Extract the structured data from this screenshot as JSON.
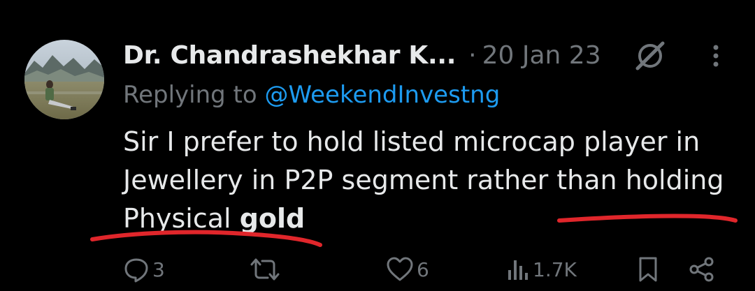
{
  "tweet": {
    "author_name": "Dr. Chandrashekhar K...",
    "separator": "·",
    "date": "20 Jan 23",
    "replying_prefix": "Replying to",
    "replying_handle": "@WeekendInvestng",
    "body_lines": [
      "Sir I prefer to hold listed microcap player in",
      "Jewellery in P2P segment rather than holding"
    ],
    "body_last_line_prefix": "Physical",
    "body_bold_word": "gold",
    "icons": {
      "grok": "grok-icon",
      "more": "more-vertical-icon",
      "reply": "reply-icon",
      "retweet": "retweet-icon",
      "like": "heart-icon",
      "views": "views-icon",
      "bookmark": "bookmark-icon",
      "share": "share-icon"
    }
  },
  "actions": {
    "replies": "3",
    "retweets": "",
    "likes": "6",
    "views": "1.7K"
  },
  "colors": {
    "background": "#000000",
    "text": "#e7e9ea",
    "muted": "#71767b",
    "link": "#1d9bf0",
    "annotation": "#e0262b"
  }
}
